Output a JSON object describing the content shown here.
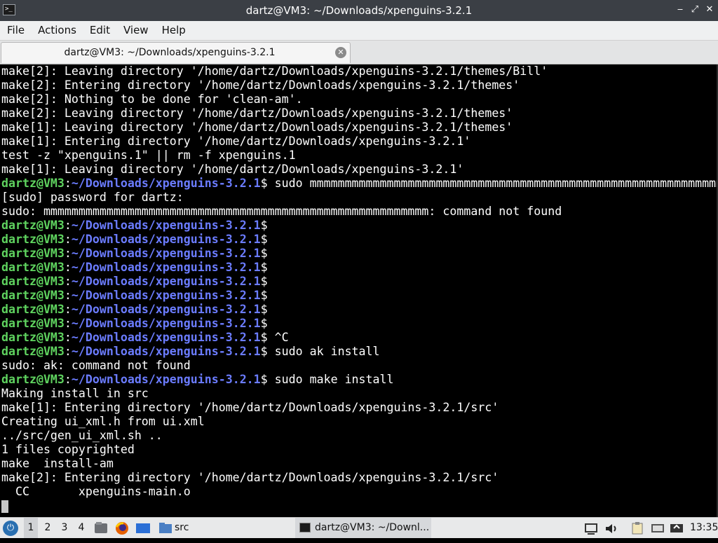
{
  "window": {
    "title": "dartz@VM3: ~/Downloads/xpenguins-3.2.1",
    "app_icon_glyph": ">_",
    "controls": {
      "minimize": "‒",
      "maximize": "⤢",
      "close": "✕"
    }
  },
  "menu": {
    "items": [
      "File",
      "Actions",
      "Edit",
      "View",
      "Help"
    ]
  },
  "tab": {
    "label": "dartz@VM3: ~/Downloads/xpenguins-3.2.1",
    "close_glyph": "✕"
  },
  "terminal": {
    "prompt_user": "dartz@VM3",
    "prompt_sep": ":",
    "prompt_path": "~/Downloads/xpenguins-3.2.1",
    "prompt_suffix": "$",
    "colors": {
      "user": "#5fd35f",
      "path": "#6b7cff",
      "text": "#ffffff",
      "background": "#000000"
    },
    "lines": [
      {
        "type": "out",
        "text": "make[2]: Leaving directory '/home/dartz/Downloads/xpenguins-3.2.1/themes/Bill'"
      },
      {
        "type": "out",
        "text": "make[2]: Entering directory '/home/dartz/Downloads/xpenguins-3.2.1/themes'"
      },
      {
        "type": "out",
        "text": "make[2]: Nothing to be done for 'clean-am'."
      },
      {
        "type": "out",
        "text": "make[2]: Leaving directory '/home/dartz/Downloads/xpenguins-3.2.1/themes'"
      },
      {
        "type": "out",
        "text": "make[1]: Leaving directory '/home/dartz/Downloads/xpenguins-3.2.1/themes'"
      },
      {
        "type": "out",
        "text": "make[1]: Entering directory '/home/dartz/Downloads/xpenguins-3.2.1'"
      },
      {
        "type": "out",
        "text": "test -z \"xpenguins.1\" || rm -f xpenguins.1"
      },
      {
        "type": "out",
        "text": "make[1]: Leaving directory '/home/dartz/Downloads/xpenguins-3.2.1'"
      },
      {
        "type": "prompt",
        "text": " sudo mmmmmmmmmmmmmmmmmmmmmmmmmmmmmmmmmmmmmmmmmmmmmmmmmmmmmmmmmmmmm"
      },
      {
        "type": "out",
        "text": "[sudo] password for dartz:"
      },
      {
        "type": "out",
        "text": "sudo: mmmmmmmmmmmmmmmmmmmmmmmmmmmmmmmmmmmmmmmmmmmmmmmmmmmmmmm: command not found"
      },
      {
        "type": "prompt",
        "text": ""
      },
      {
        "type": "prompt",
        "text": ""
      },
      {
        "type": "prompt",
        "text": ""
      },
      {
        "type": "prompt",
        "text": ""
      },
      {
        "type": "prompt",
        "text": ""
      },
      {
        "type": "prompt",
        "text": ""
      },
      {
        "type": "prompt",
        "text": ""
      },
      {
        "type": "prompt",
        "text": ""
      },
      {
        "type": "prompt",
        "text": " ^C"
      },
      {
        "type": "prompt",
        "text": " sudo ak install"
      },
      {
        "type": "out",
        "text": "sudo: ak: command not found"
      },
      {
        "type": "prompt",
        "text": " sudo make install"
      },
      {
        "type": "out",
        "text": "Making install in src"
      },
      {
        "type": "out",
        "text": "make[1]: Entering directory '/home/dartz/Downloads/xpenguins-3.2.1/src'"
      },
      {
        "type": "out",
        "text": "Creating ui_xml.h from ui.xml"
      },
      {
        "type": "out",
        "text": "../src/gen_ui_xml.sh .."
      },
      {
        "type": "out",
        "text": "1 files copyrighted"
      },
      {
        "type": "out",
        "text": "make  install-am"
      },
      {
        "type": "out",
        "text": "make[2]: Entering directory '/home/dartz/Downloads/xpenguins-3.2.1/src'"
      },
      {
        "type": "out",
        "text": "  CC       xpenguins-main.o"
      }
    ]
  },
  "taskbar": {
    "launcher_icon": "start-menu-icon",
    "workspaces": [
      "1",
      "2",
      "3",
      "4"
    ],
    "active_workspace": "1",
    "quick_launch": [
      "file-manager-icon",
      "firefox-icon",
      "show-desktop-icon"
    ],
    "folder_label": "src",
    "task_label": "dartz@VM3: ~/Downl...",
    "tray_icons": [
      "volume-icon",
      "clipboard-icon",
      "display-icon",
      "network-icon"
    ],
    "clock": "13:35"
  }
}
